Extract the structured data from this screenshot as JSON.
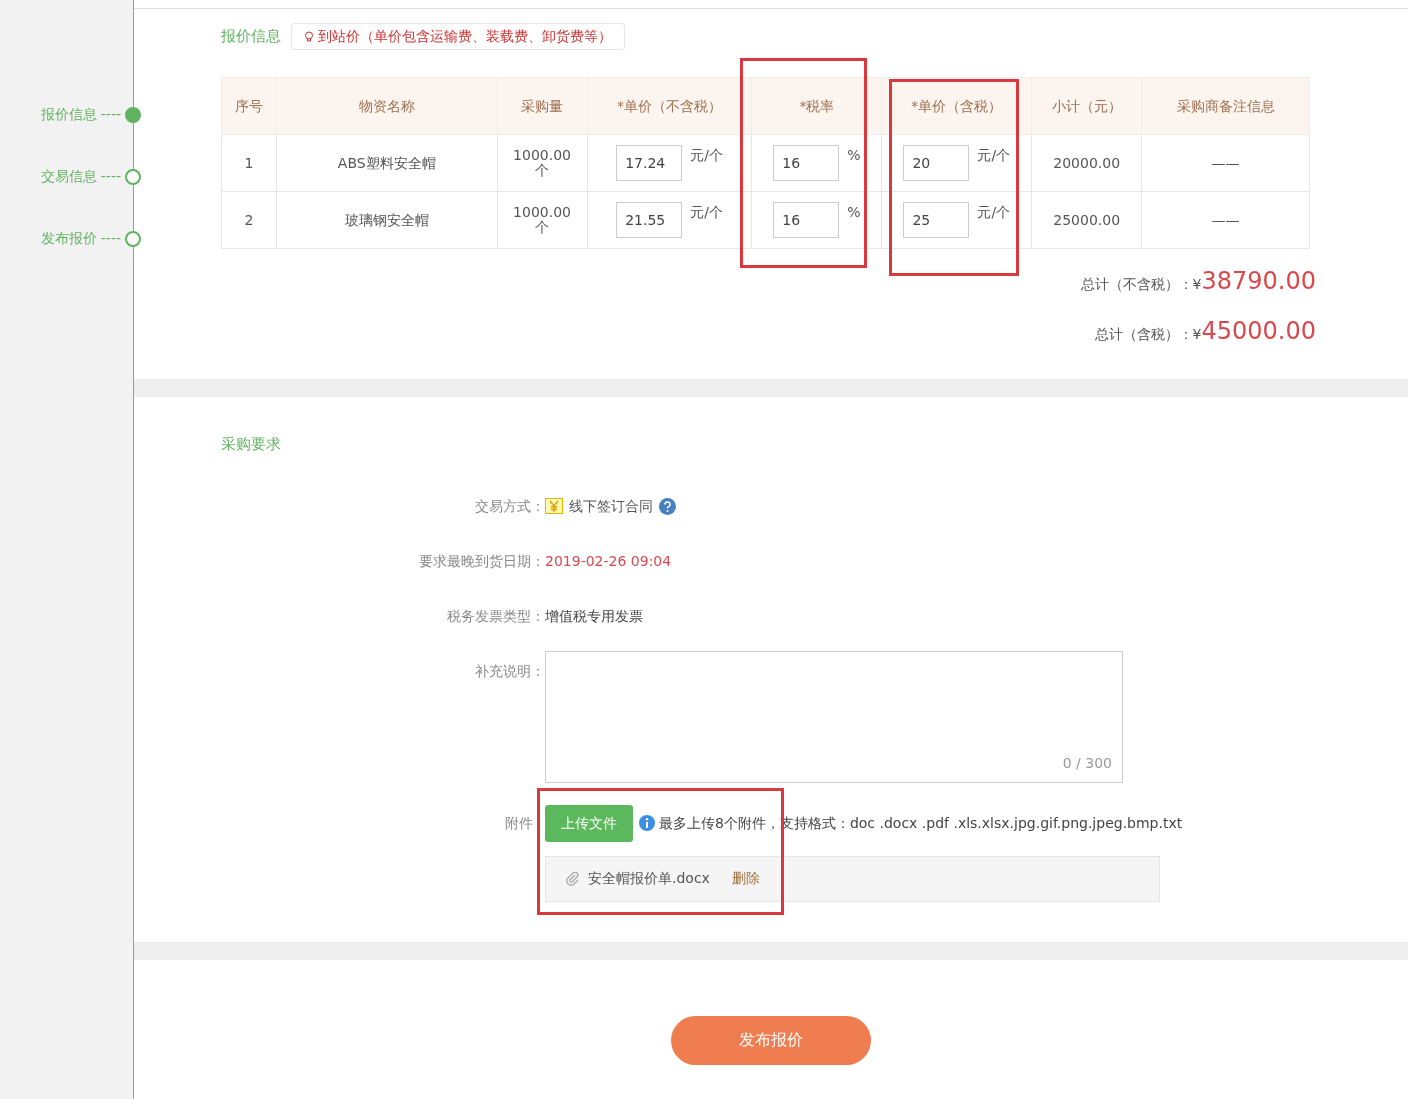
{
  "timeline": [
    {
      "label": "报价信息",
      "connector": "----",
      "selected": true
    },
    {
      "label": "交易信息",
      "connector": "----",
      "selected": false
    },
    {
      "label": "发布报价",
      "connector": "----",
      "selected": false
    }
  ],
  "quote": {
    "title": "报价信息",
    "notice": "到站价（单价包含运输费、装载费、卸货费等）",
    "columns": [
      "序号",
      "物资名称",
      "采购量",
      "*单价（不含税）",
      "*税率",
      "*单价（含税）",
      "小计（元）",
      "采购商备注信息"
    ],
    "rows": [
      {
        "index": "1",
        "name": "ABS塑料安全帽",
        "quantity": "1000.00个",
        "unit_price": "17.24",
        "unit_price_unit": "元/个",
        "tax_rate": "16",
        "tax_rate_unit": "%",
        "unit_price_tax": "20",
        "unit_price_tax_unit": "元/个",
        "subtotal": "20000.00",
        "remark": "——"
      },
      {
        "index": "2",
        "name": "玻璃钢安全帽",
        "quantity": "1000.00个",
        "unit_price": "21.55",
        "unit_price_unit": "元/个",
        "tax_rate": "16",
        "tax_rate_unit": "%",
        "unit_price_tax": "25",
        "unit_price_tax_unit": "元/个",
        "subtotal": "25000.00",
        "remark": "——"
      }
    ],
    "totals": [
      {
        "label": "总计（不含税）：",
        "currency": "¥",
        "amount": "38790.00"
      },
      {
        "label": "总计（含税）：",
        "currency": "¥",
        "amount": "45000.00"
      }
    ]
  },
  "requirements": {
    "title": "采购要求",
    "trade_method": {
      "label": "交易方式：",
      "value": "线下签订合同"
    },
    "delivery_date": {
      "label": "要求最晚到货日期：",
      "value": "2019-02-26 09:04"
    },
    "invoice_type": {
      "label": "税务发票类型：",
      "value": "增值税专用发票"
    },
    "remarks": {
      "label": "补充说明：",
      "counter": "0 / 300"
    },
    "attachments": {
      "label": "附件",
      "upload_button": "上传文件",
      "hint": "最多上传8个附件，支持格式：doc .docx .pdf .xls.xlsx.jpg.gif.png.jpeg.bmp.txt",
      "files": [
        {
          "name": "安全帽报价单.docx",
          "delete": "删除"
        }
      ]
    }
  },
  "submit_button": "发布报价"
}
